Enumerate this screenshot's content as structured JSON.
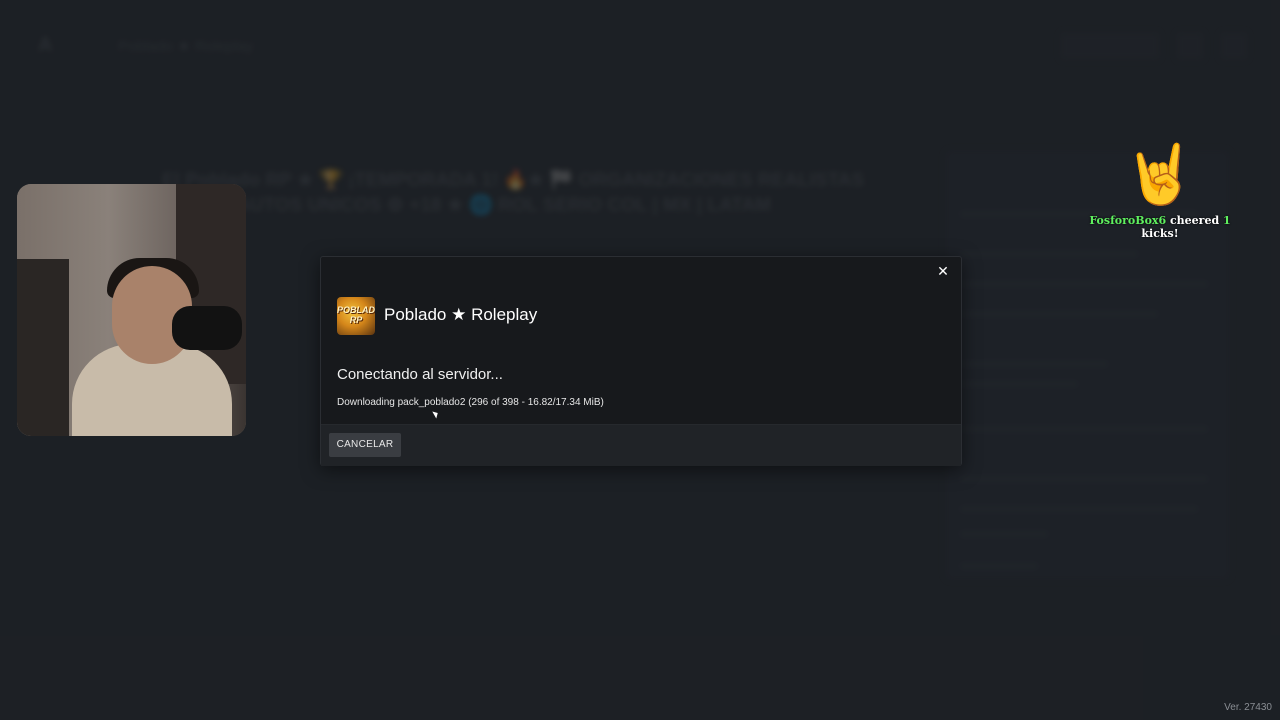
{
  "background": {
    "app_title": "Poblado ★ Roleplay",
    "server_listing_title": "El Poblado RP ★ 🏆 ¡TEMPORADA 1! 🔥★ 🏁 ORGANIZACIONES REALISTAS 🔷★ 🎮 AUTOS UNICOS ⚙ +18 ★ 🌐 ROL SERIO COL | MX | LATAM"
  },
  "modal": {
    "server_name": "Poblado ★ Roleplay",
    "server_icon_text": "POBLADO RP",
    "status": "Conectando al servidor...",
    "progress": "Downloading pack_poblado2 (296 of 398 - 16.82/17.34 MiB)",
    "cancel_label": "CANCELAR",
    "close_glyph": "✕"
  },
  "alert": {
    "hand_emoji": "🤘",
    "username": "FosforoBox6",
    "verb": "cheered",
    "count": "1",
    "unit": "kicks!"
  },
  "version": "Ver. 27430",
  "colors": {
    "background": "#202328",
    "modal": "#17191c",
    "footer": "#202327",
    "button": "#3a3d42",
    "alert_green": "#5ff05f"
  }
}
